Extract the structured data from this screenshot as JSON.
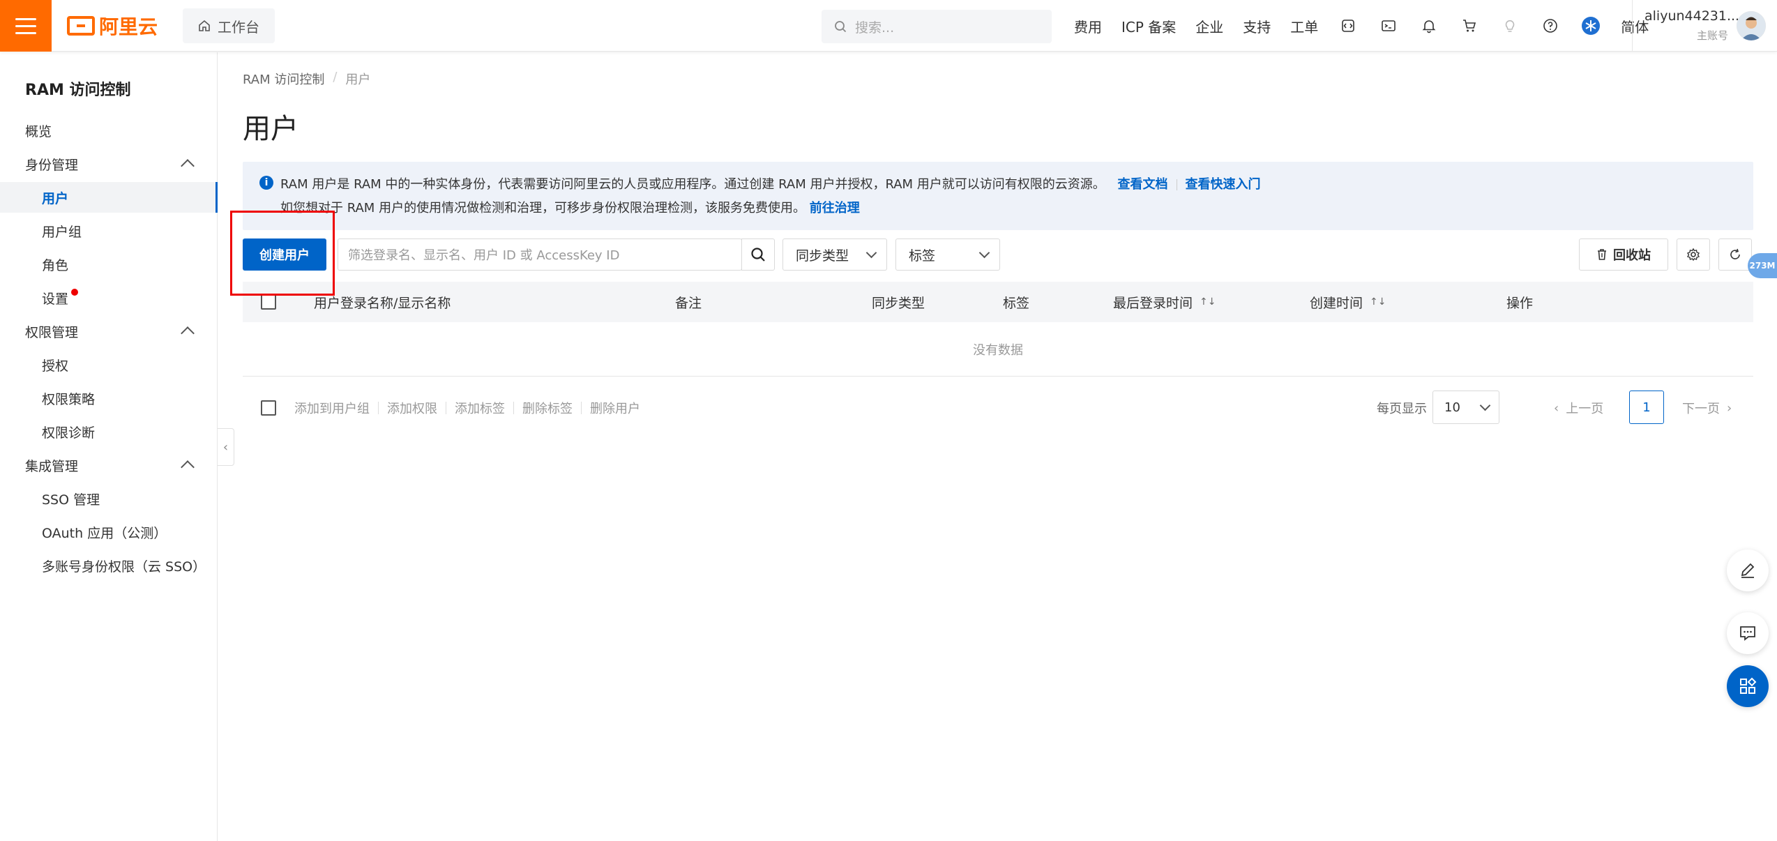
{
  "topbar": {
    "logo_text": "阿里云",
    "workbench_label": "工作台",
    "search_placeholder": "搜索...",
    "links": [
      "费用",
      "ICP 备案",
      "企业",
      "支持",
      "工单"
    ],
    "lang": "简体",
    "user_name": "aliyun44231...",
    "user_sub": "主账号"
  },
  "sidebar": {
    "title": "RAM 访问控制",
    "items": [
      {
        "label": "概览"
      },
      {
        "label": "身份管理"
      },
      {
        "label": "用户"
      },
      {
        "label": "用户组"
      },
      {
        "label": "角色"
      },
      {
        "label": "设置"
      },
      {
        "label": "权限管理"
      },
      {
        "label": "授权"
      },
      {
        "label": "权限策略"
      },
      {
        "label": "权限诊断"
      },
      {
        "label": "集成管理"
      },
      {
        "label": "SSO 管理"
      },
      {
        "label": "OAuth 应用（公测）"
      },
      {
        "label": "多账号身份权限（云 SSO）"
      }
    ]
  },
  "breadcrumb": {
    "root": "RAM 访问控制",
    "sep": "/",
    "current": "用户"
  },
  "page_title": "用户",
  "info": {
    "line1": "RAM 用户是 RAM 中的一种实体身份，代表需要访问阿里云的人员或应用程序。通过创建 RAM 用户并授权，RAM 用户就可以访问有权限的云资源。",
    "link_docs": "查看文档",
    "link_quickstart": "查看快速入门",
    "line2": "如您想对于 RAM 用户的使用情况做检测和治理，可移步身份权限治理检测，该服务免费使用。",
    "link_govern": "前往治理"
  },
  "toolbar": {
    "create_label": "创建用户",
    "filter_placeholder": "筛选登录名、显示名、用户 ID 或 AccessKey ID",
    "sync_type": "同步类型",
    "tags": "标签",
    "recycle": "回收站"
  },
  "table": {
    "columns": [
      "用户登录名称/显示名称",
      "备注",
      "同步类型",
      "标签",
      "最后登录时间",
      "创建时间",
      "操作"
    ],
    "empty": "没有数据"
  },
  "batch_actions": [
    "添加到用户组",
    "添加权限",
    "添加标签",
    "删除标签",
    "删除用户"
  ],
  "pagination": {
    "per_page_label": "每页显示",
    "per_page": "10",
    "prev": "上一页",
    "current": "1",
    "next": "下一页"
  },
  "memory_badge": "273M",
  "colors": {
    "brand": "#ff6a00",
    "primary": "#0064c8",
    "highlight": "#e00000"
  }
}
